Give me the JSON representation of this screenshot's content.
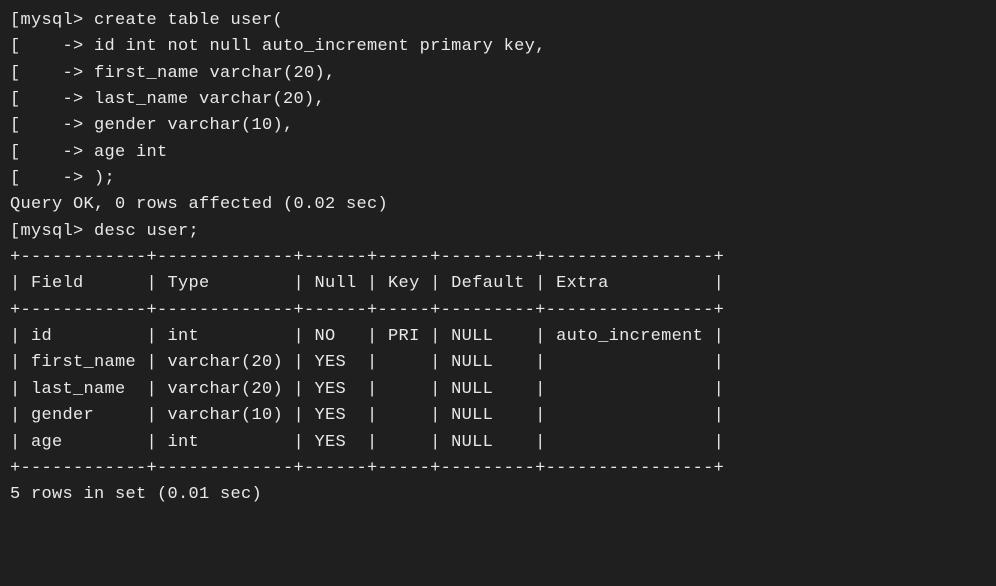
{
  "terminal": {
    "lines": [
      "[mysql> create table user(",
      "[    -> id int not null auto_increment primary key,",
      "[    -> first_name varchar(20),",
      "[    -> last_name varchar(20),",
      "[    -> gender varchar(10),",
      "[    -> age int",
      "[    -> );",
      "Query OK, 0 rows affected (0.02 sec)",
      "",
      "[mysql> desc user;",
      "+------------+-------------+------+-----+---------+----------------+",
      "| Field      | Type        | Null | Key | Default | Extra          |",
      "+------------+-------------+------+-----+---------+----------------+",
      "| id         | int         | NO   | PRI | NULL    | auto_increment |",
      "| first_name | varchar(20) | YES  |     | NULL    |                |",
      "| last_name  | varchar(20) | YES  |     | NULL    |                |",
      "| gender     | varchar(10) | YES  |     | NULL    |                |",
      "| age        | int         | YES  |     | NULL    |                |",
      "+------------+-------------+------+-----+---------+----------------+",
      "5 rows in set (0.01 sec)"
    ]
  },
  "chart_data": {
    "type": "table",
    "title": "desc user",
    "columns": [
      "Field",
      "Type",
      "Null",
      "Key",
      "Default",
      "Extra"
    ],
    "rows": [
      {
        "Field": "id",
        "Type": "int",
        "Null": "NO",
        "Key": "PRI",
        "Default": "NULL",
        "Extra": "auto_increment"
      },
      {
        "Field": "first_name",
        "Type": "varchar(20)",
        "Null": "YES",
        "Key": "",
        "Default": "NULL",
        "Extra": ""
      },
      {
        "Field": "last_name",
        "Type": "varchar(20)",
        "Null": "YES",
        "Key": "",
        "Default": "NULL",
        "Extra": ""
      },
      {
        "Field": "gender",
        "Type": "varchar(10)",
        "Null": "YES",
        "Key": "",
        "Default": "NULL",
        "Extra": ""
      },
      {
        "Field": "age",
        "Type": "int",
        "Null": "YES",
        "Key": "",
        "Default": "NULL",
        "Extra": ""
      }
    ],
    "create_statement": {
      "table": "user",
      "columns": [
        {
          "name": "id",
          "definition": "int not null auto_increment primary key"
        },
        {
          "name": "first_name",
          "definition": "varchar(20)"
        },
        {
          "name": "last_name",
          "definition": "varchar(20)"
        },
        {
          "name": "gender",
          "definition": "varchar(10)"
        },
        {
          "name": "age",
          "definition": "int"
        }
      ]
    },
    "result_messages": {
      "create": "Query OK, 0 rows affected (0.02 sec)",
      "describe": "5 rows in set (0.01 sec)"
    }
  }
}
